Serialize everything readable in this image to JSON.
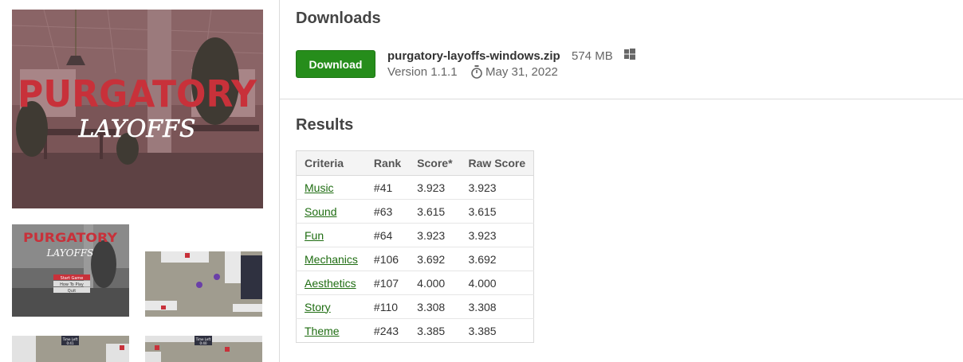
{
  "cover": {
    "title_line1": "PURGATORY",
    "title_line2": "LAYOFFS"
  },
  "screenshots": {
    "menu_title": "PURGATORY",
    "menu_subtitle": "LAYOFFS",
    "menu_items": [
      "Start Game",
      "How To Play",
      "Quit"
    ],
    "time_label": "Time Left",
    "time_value": "0:41",
    "time_value_2": "0:40"
  },
  "downloads": {
    "heading": "Downloads",
    "button_label": "Download",
    "file_name": "purgatory-layoffs-windows.zip",
    "file_size": "574 MB",
    "platform_icon": "windows-icon",
    "version": "Version 1.1.1",
    "date_icon": "stopwatch-icon",
    "date": "May 31, 2022"
  },
  "results": {
    "heading": "Results",
    "columns": [
      "Criteria",
      "Rank",
      "Score*",
      "Raw Score"
    ],
    "rows": [
      {
        "criteria": "Music",
        "rank": "#41",
        "score": "3.923",
        "raw": "3.923"
      },
      {
        "criteria": "Sound",
        "rank": "#63",
        "score": "3.615",
        "raw": "3.615"
      },
      {
        "criteria": "Fun",
        "rank": "#64",
        "score": "3.923",
        "raw": "3.923"
      },
      {
        "criteria": "Mechanics",
        "rank": "#106",
        "score": "3.692",
        "raw": "3.692"
      },
      {
        "criteria": "Aesthetics",
        "rank": "#107",
        "score": "4.000",
        "raw": "4.000"
      },
      {
        "criteria": "Story",
        "rank": "#110",
        "score": "3.308",
        "raw": "3.308"
      },
      {
        "criteria": "Theme",
        "rank": "#243",
        "score": "3.385",
        "raw": "3.385"
      }
    ]
  },
  "colors": {
    "download_button": "#268d1b",
    "link": "#1f6d12",
    "cover_title": "#c8313a"
  }
}
